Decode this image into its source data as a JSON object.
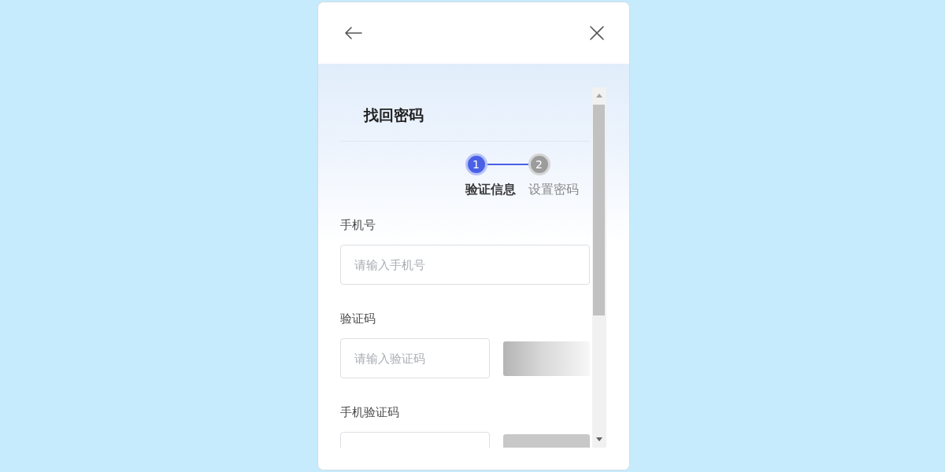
{
  "form": {
    "title": "找回密码",
    "steps": [
      {
        "number": "1",
        "label": "验证信息",
        "selected": true
      },
      {
        "number": "2",
        "label": "设置密码",
        "selected": false
      }
    ],
    "fields": [
      {
        "kind": "text",
        "label": "手机号",
        "placeholder": "请输入手机号"
      },
      {
        "kind": "captcha",
        "label": "验证码",
        "placeholder": "请输入验证码"
      },
      {
        "kind": "code",
        "label": "手机验证码"
      }
    ]
  }
}
